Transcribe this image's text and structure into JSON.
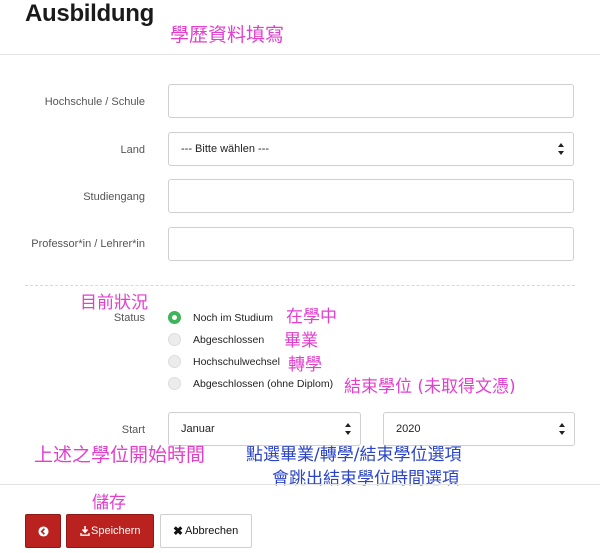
{
  "page": {
    "title": "Ausbildung",
    "annotation_title": "學歷資料填寫"
  },
  "form": {
    "school_label": "Hochschule / Schule",
    "school_value": "",
    "country_label": "Land",
    "country_value": "--- Bitte wählen ---",
    "study_label": "Studiengang",
    "study_value": "",
    "professor_label": "Professor*in / Lehrer*in",
    "professor_value": ""
  },
  "status": {
    "label": "Status",
    "options": [
      {
        "label": "Noch im Studium",
        "selected": true
      },
      {
        "label": "Abgeschlossen",
        "selected": false
      },
      {
        "label": "Hochschulwechsel",
        "selected": false
      },
      {
        "label": "Abgeschlossen (ohne Diplom)",
        "selected": false
      }
    ],
    "annotation_heading": "目前狀況",
    "annotation_options": [
      "在學中",
      "畢業",
      "轉學",
      "結束學位 (未取得文憑)"
    ]
  },
  "start": {
    "label": "Start",
    "month_value": "Januar",
    "year_value": "2020",
    "annotation_left": "上述之學位開始時間",
    "annotation_right_line1": "點選畢業/轉學/結束學位選項",
    "annotation_right_line2": "會跳出結束學位時間選項"
  },
  "actions": {
    "back_icon": "back-circle-icon",
    "save_label": "Speichern",
    "save_icon": "download-icon",
    "cancel_label": "Abbrechen",
    "cancel_icon": "times-icon",
    "annotation_save": "儲存"
  },
  "colors": {
    "primary_red": "#b9221e",
    "radio_green": "#3eb55a",
    "annotation_pink": "#e23fcf",
    "annotation_blue": "#2b44c6"
  }
}
